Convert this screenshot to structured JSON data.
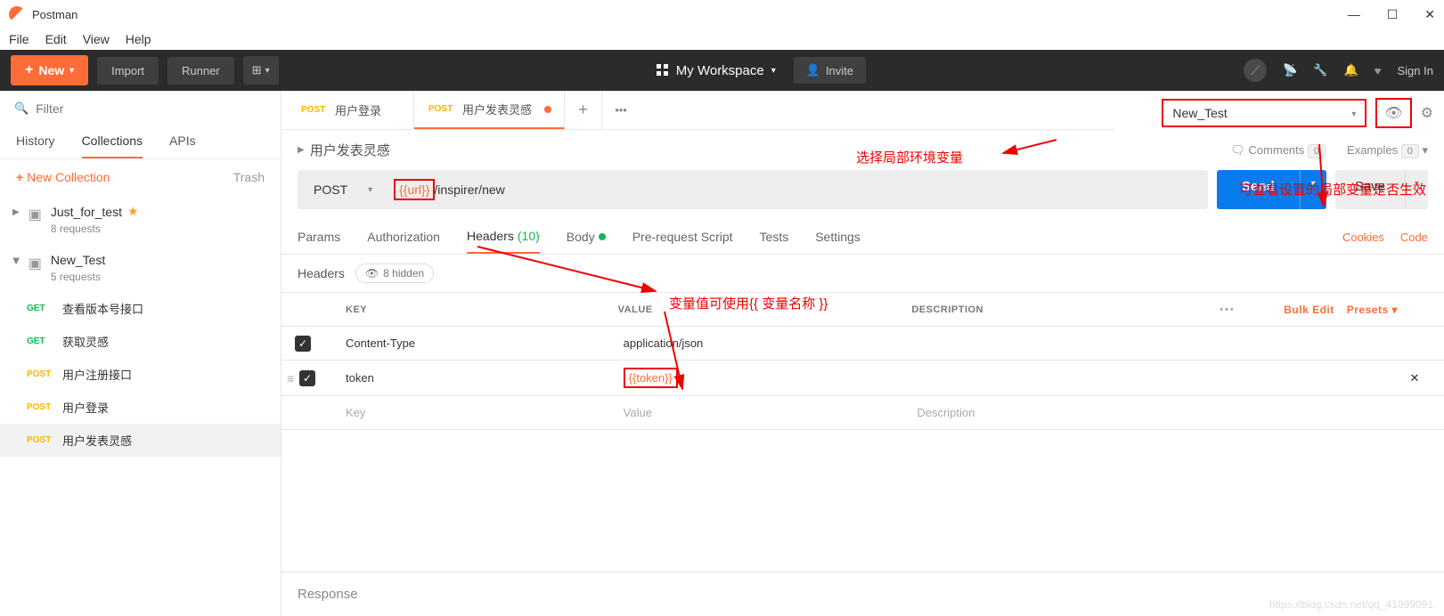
{
  "window": {
    "title": "Postman"
  },
  "menubar": {
    "file": "File",
    "edit": "Edit",
    "view": "View",
    "help": "Help"
  },
  "topbar": {
    "new": "New",
    "import": "Import",
    "runner": "Runner",
    "workspace": "My Workspace",
    "invite": "Invite",
    "signin": "Sign In"
  },
  "sidebar": {
    "filter_placeholder": "Filter",
    "tabs": {
      "history": "History",
      "collections": "Collections",
      "apis": "APIs"
    },
    "new_collection": "New Collection",
    "trash": "Trash",
    "collections": [
      {
        "name": "Just_for_test",
        "starred": true,
        "sub": "8 requests"
      },
      {
        "name": "New_Test",
        "starred": false,
        "sub": "5 requests"
      }
    ],
    "requests": [
      {
        "method": "GET",
        "name": "查看版本号接口"
      },
      {
        "method": "GET",
        "name": "获取灵感"
      },
      {
        "method": "POST",
        "name": "用户注册接口"
      },
      {
        "method": "POST",
        "name": "用户登录"
      },
      {
        "method": "POST",
        "name": "用户发表灵感"
      }
    ]
  },
  "env": {
    "selected": "New_Test"
  },
  "tabs": [
    {
      "method": "POST",
      "title": "用户登录",
      "active": false
    },
    {
      "method": "POST",
      "title": "用户发表灵感",
      "active": true
    }
  ],
  "crumb": {
    "title": "用户发表灵感"
  },
  "meta": {
    "comments": "Comments",
    "comments_n": "0",
    "examples": "Examples",
    "examples_n": "0"
  },
  "request": {
    "method": "POST",
    "url_var": "{{url}}",
    "url_rest": "/inspirer/new",
    "send": "Send",
    "save": "Save"
  },
  "rtabs": {
    "params": "Params",
    "auth": "Authorization",
    "headers": "Headers",
    "headers_n": "(10)",
    "body": "Body",
    "prereq": "Pre-request Script",
    "tests": "Tests",
    "settings": "Settings",
    "cookies": "Cookies",
    "code": "Code"
  },
  "headers_sub": {
    "title": "Headers",
    "hidden": "8 hidden"
  },
  "table": {
    "head": {
      "key": "KEY",
      "value": "VALUE",
      "desc": "DESCRIPTION",
      "bulk": "Bulk Edit",
      "presets": "Presets"
    },
    "rows": [
      {
        "key": "Content-Type",
        "value": "application/json"
      },
      {
        "key": "token",
        "value": "{{token}}",
        "highlight": true
      }
    ],
    "ph": {
      "key": "Key",
      "value": "Value",
      "desc": "Description"
    }
  },
  "response": "Response",
  "annotations": {
    "a1": "选择局部环境变量",
    "a2": "可查看设置的局部变量是否生效",
    "a3": "变量值可使用{{ 变量名称 }}"
  },
  "watermark": "https://blog.csdn.net/qq_41099091"
}
